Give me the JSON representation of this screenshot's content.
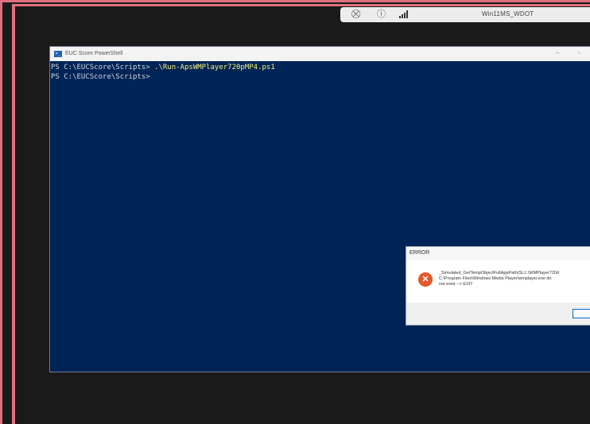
{
  "session": {
    "machine_name": "Win11MS_WDOT",
    "icons": [
      "network-off-icon",
      "lock-icon",
      "signal-icon"
    ]
  },
  "powershell": {
    "title": "EUC Score PowerShell",
    "lines": [
      {
        "prompt": "PS C:\\EUCScore\\Scripts> ",
        "command": ".\\Run-ApsWMPlayer720pMP4.ps1"
      },
      {
        "prompt": "PS C:\\EUCScore\\Scripts> ",
        "command": ""
      }
    ]
  },
  "error_dialog": {
    "title": "ERROR",
    "message": "_Simulated_GetTempObjectFullAppPath(SL1:\\WMPlayer720d\nC:\\Program Files\\Windows Media Player\\wmplayer.exe do\nnot exist --> EXIT",
    "icon": "error-x-icon",
    "icon_color": "#e3572b"
  },
  "colors": {
    "frame_border": "#e0707e",
    "console_bg": "#012456",
    "console_command": "#f3ef7a"
  }
}
